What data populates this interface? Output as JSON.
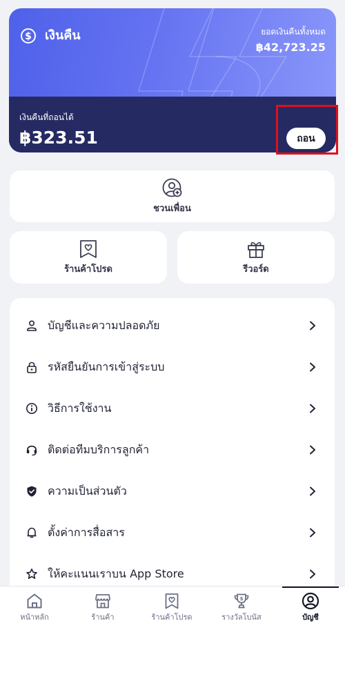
{
  "cashback_card": {
    "title": "เงินคืน",
    "total_label": "ยอดเงินคืนทั้งหมด",
    "total_value": "฿42,723.25",
    "withdrawable_label": "เงินคืนที่ถอนได้",
    "withdrawable_value": "฿323.51",
    "withdraw_button": "ถอน",
    "accent_color": "#4f61ea",
    "dark_color": "#252a63"
  },
  "tiles": {
    "invite_label": "ชวนเพื่อน",
    "favorite_shops_label": "ร้านค้าโปรด",
    "rewards_label": "รีวอร์ด"
  },
  "menu": {
    "items": [
      {
        "label": "บัญชีและความปลอดภัย",
        "icon": "person-icon"
      },
      {
        "label": "รหัสยืนยันการเข้าสู่ระบบ",
        "icon": "lock-icon"
      },
      {
        "label": "วิธีการใช้งาน",
        "icon": "info-icon"
      },
      {
        "label": "ติดต่อทีมบริการลูกค้า",
        "icon": "headset-icon"
      },
      {
        "label": "ความเป็นส่วนตัว",
        "icon": "shield-icon"
      },
      {
        "label": "ตั้งค่าการสื่อสาร",
        "icon": "bell-icon"
      },
      {
        "label": "ให้คะแนนเราบน App Store",
        "icon": "star-icon"
      }
    ]
  },
  "bottom_nav": {
    "items": [
      {
        "label": "หน้าหลัก",
        "icon": "home-icon"
      },
      {
        "label": "ร้านค้า",
        "icon": "store-icon"
      },
      {
        "label": "ร้านค้าโปรด",
        "icon": "favorite-shop-icon"
      },
      {
        "label": "รางวัลโบนัส",
        "icon": "trophy-icon"
      },
      {
        "label": "บัญชี",
        "icon": "account-icon"
      }
    ],
    "active": "บัญชี"
  }
}
